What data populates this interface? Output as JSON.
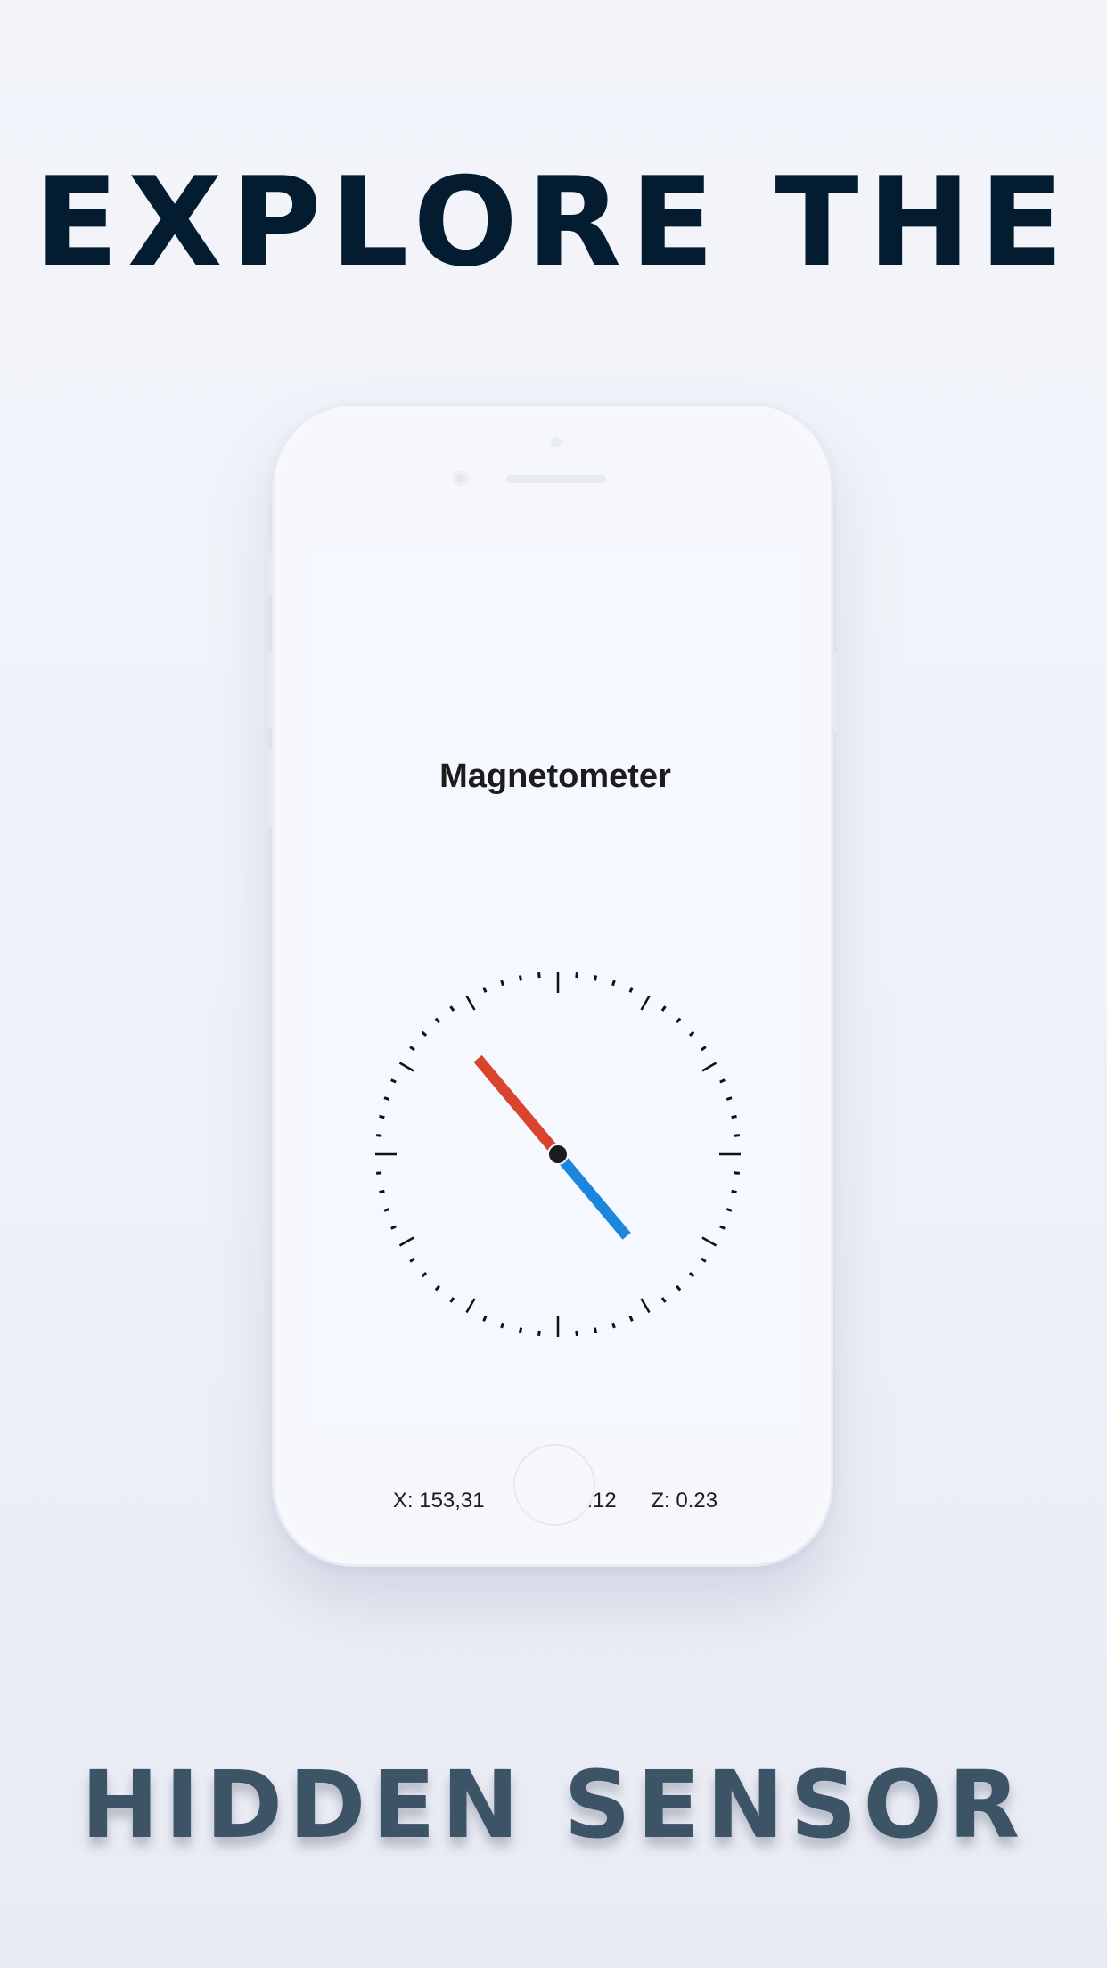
{
  "headline": {
    "top": "EXPLORE THE",
    "bottom": "HIDDEN SENSOR"
  },
  "app": {
    "title": "Magnetometer",
    "readouts": {
      "x": "X: 153,31",
      "y": "Y: -622.12",
      "z": "Z: 0.23"
    }
  },
  "compass": {
    "needle_angle_deg": -40,
    "colors": {
      "north": "#d8442e",
      "south": "#1a86de",
      "pivot": "#1c1c1c",
      "ticks": "#111111"
    }
  },
  "colors": {
    "headline_top": "#031c2f",
    "headline_bottom": "#3d5467",
    "background": "#f1f3f9"
  }
}
